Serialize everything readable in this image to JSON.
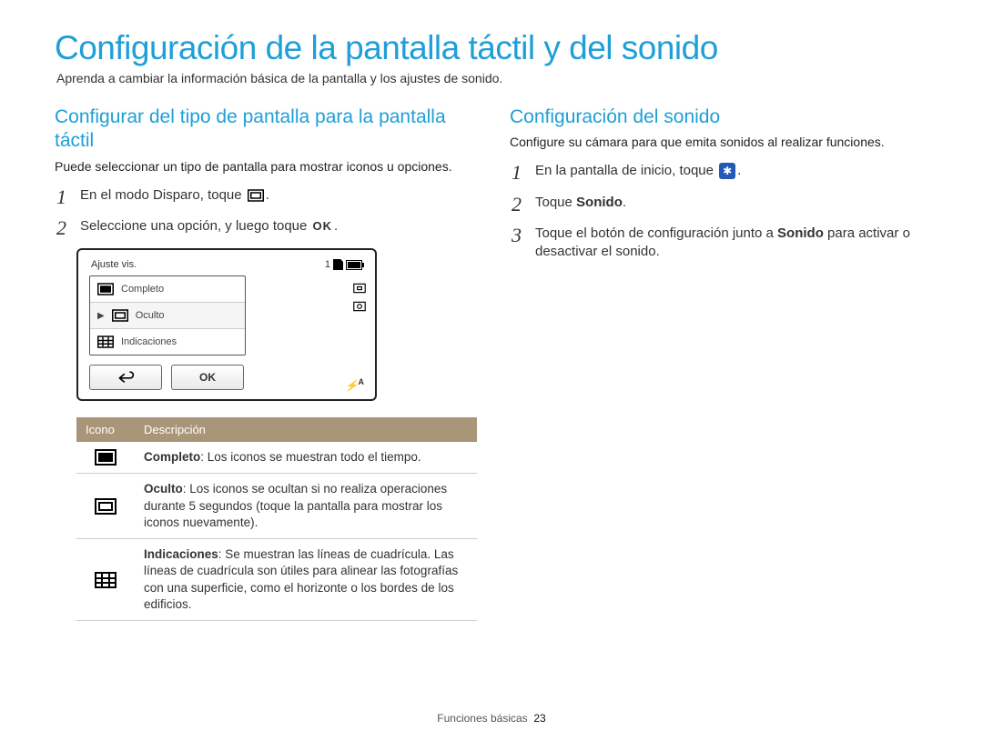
{
  "pageTitle": "Configuración de la pantalla táctil y del sonido",
  "intro": "Aprenda a cambiar la información básica de la pantalla y los ajustes de sonido.",
  "left": {
    "heading": "Configurar del tipo de pantalla para la pantalla táctil",
    "sub": "Puede seleccionar un tipo de pantalla para mostrar iconos u opciones.",
    "step1": "En el modo Disparo, toque ",
    "step2a": "Seleccione una opción, y luego toque ",
    "okLabel": "OK",
    "period": "."
  },
  "display": {
    "title": "Ajuste vis.",
    "count": "1",
    "items": {
      "completo": "Completo",
      "oculto": "Oculto",
      "indicaciones": "Indicaciones"
    },
    "ok": "OK",
    "flash": "A"
  },
  "table": {
    "h1": "Icono",
    "h2": "Descripción",
    "r1b": "Completo",
    "r1": ": Los iconos se muestran todo el tiempo.",
    "r2b": "Oculto",
    "r2": ": Los iconos se ocultan si no realiza operaciones durante 5 segundos (toque la pantalla para mostrar los iconos nuevamente).",
    "r3b": "Indicaciones",
    "r3": ": Se muestran las líneas de cuadrícula. Las líneas de cuadrícula son útiles para alinear las fotografías con una superficie, como el horizonte o los bordes de los edificios."
  },
  "right": {
    "heading": "Configuración del sonido",
    "sub": "Configure su cámara para que emita sonidos al realizar funciones.",
    "step1": "En la pantalla de inicio, toque ",
    "step2a": "Toque ",
    "step2b": "Sonido",
    "step3a": "Toque el botón de configuración junto a ",
    "step3b": "Sonido",
    "step3c": " para activar o desactivar el sonido.",
    "period": "."
  },
  "footer": {
    "section": "Funciones básicas",
    "page": "23"
  }
}
